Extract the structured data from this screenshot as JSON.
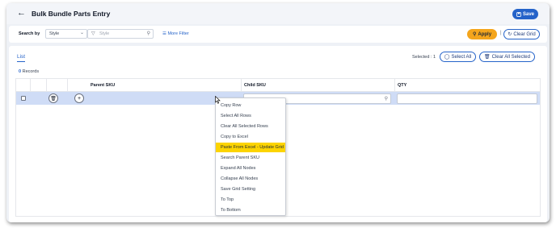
{
  "header": {
    "title": "Bulk Bundle Parts Entry",
    "save_label": "Save",
    "back_icon": "arrow-left-icon"
  },
  "filters": {
    "search_by_label": "Search by",
    "search_field_value": "Style",
    "search_placeholder": "Style",
    "more_filter_label": "More Filter",
    "apply_label": "Apply",
    "clear_grid_label": "Clear Grid"
  },
  "list": {
    "tab_label": "List",
    "records_count": "0",
    "records_label": "Records",
    "selected_label": "Selected",
    "selected_count": "1",
    "select_all_label": "Select All",
    "clear_all_selected_label": "Clear All Selected"
  },
  "grid": {
    "columns": [
      "Parent SKU",
      "Child SKU",
      "QTY"
    ],
    "row_add_symbol": "+"
  },
  "context_menu": {
    "items": [
      "Copy Row",
      "Select All Rows",
      "Clear All Selected Rows",
      "Copy to Excel",
      "Paste From Excel - Update Grid",
      "Search Parent SKU",
      "Expand All Nodes",
      "Collapse All Nodes",
      "Save Grid Setting",
      "To Top",
      "To Bottom"
    ],
    "highlighted_index": 4
  },
  "colors": {
    "accent": "#2563c9",
    "apply": "#f4a51c",
    "highlight": "#fcd400",
    "row_selected": "#cfdcf6"
  }
}
